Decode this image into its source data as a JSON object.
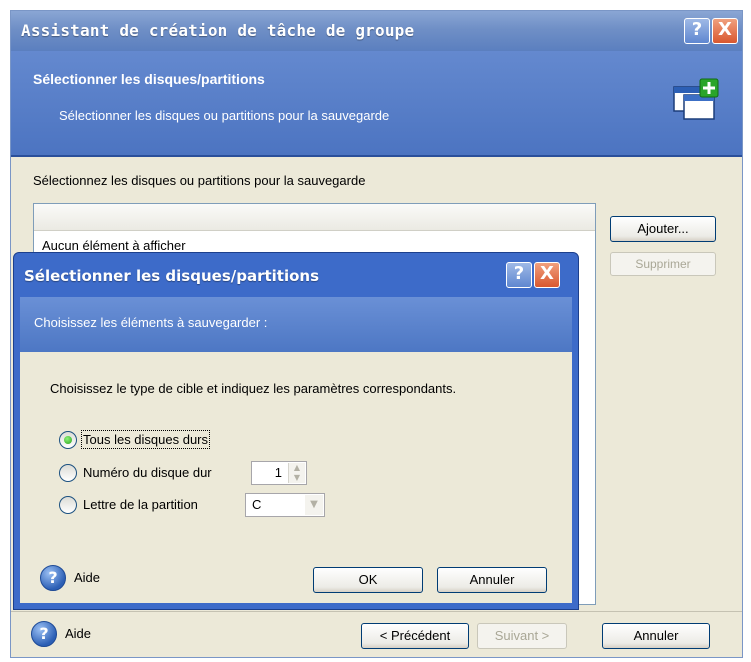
{
  "wizard": {
    "title": "Assistant de création de tâche de groupe",
    "header_title": "Sélectionner les disques/partitions",
    "header_subtitle": "Sélectionner les disques ou partitions pour la sauvegarde",
    "instruction": "Sélectionnez les disques ou partitions pour la sauvegarde",
    "list_empty": "Aucun élément à afficher",
    "add_button": "Ajouter...",
    "remove_button": "Supprimer",
    "help_label": "Aide",
    "prev_button": "< Précédent",
    "next_button": "Suivant >",
    "cancel_button": "Annuler",
    "help_glyph": "?",
    "close_glyph": "X"
  },
  "dialog": {
    "title": "Sélectionner les disques/partitions",
    "subtitle": "Choisissez les éléments à sauvegarder :",
    "instruction": "Choisissez le type de cible et indiquez les paramètres correspondants.",
    "options": [
      {
        "label": "Tous les disques durs",
        "checked": true
      },
      {
        "label": "Numéro du disque dur",
        "checked": false
      },
      {
        "label": "Lettre de la partition",
        "checked": false
      }
    ],
    "disk_number": "1",
    "partition_letter": "C",
    "help_label": "Aide",
    "ok_button": "OK",
    "cancel_button": "Annuler"
  },
  "icons": [
    "help-icon",
    "close-icon",
    "add-window-icon",
    "spin-arrows-icon",
    "dropdown-arrow-icon"
  ],
  "colors": {
    "title_blue": "#5b7fbf",
    "header_blue": "#4c74c1",
    "close_red": "#d9572f",
    "face": "#ece9d8"
  }
}
